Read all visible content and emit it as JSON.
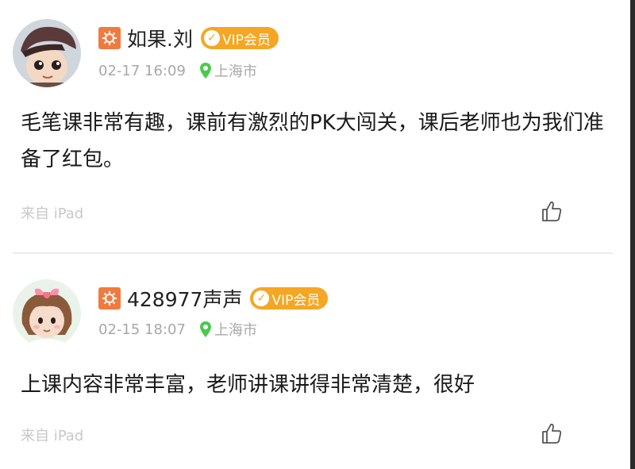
{
  "comments": [
    {
      "username": "如果.刘",
      "vip_label": "VIP会员",
      "date": "02-17 16:09",
      "location": "上海市",
      "content": "毛笔课非常有趣，课前有激烈的PK大闯关，课后老师也为我们准备了红包。",
      "source": "来自 iPad",
      "avatar_icon": "cartoon-boy-avatar",
      "like_icon": "thumbs-up-icon"
    },
    {
      "username": "428977声声",
      "vip_label": "VIP会员",
      "date": "02-15 18:07",
      "location": "上海市",
      "content": "上课内容非常丰富，老师讲课讲得非常清楚，很好",
      "source": "来自 iPad",
      "avatar_icon": "cartoon-girl-avatar",
      "like_icon": "thumbs-up-icon"
    }
  ],
  "colors": {
    "level_badge": "#f07b3f",
    "vip_badge": "#f5a623",
    "location_pin": "#4cc94c",
    "meta_text": "#a8a8a8",
    "source_text": "#c8c8c8"
  }
}
